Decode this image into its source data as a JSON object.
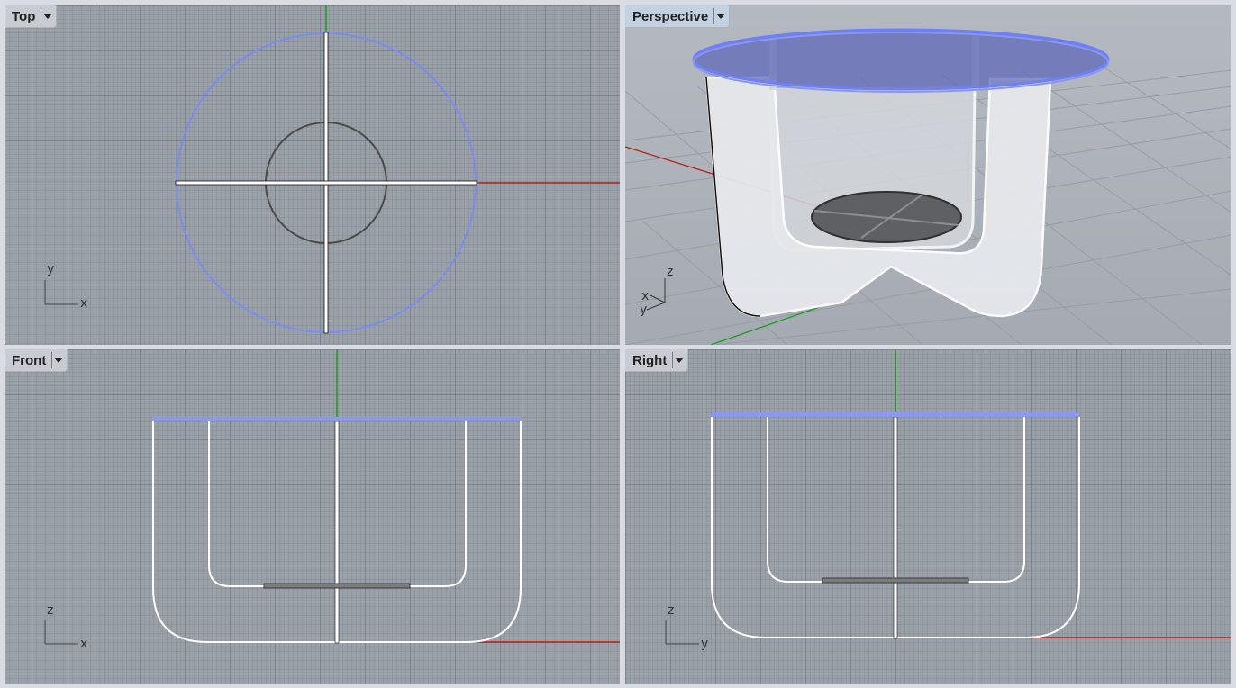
{
  "viewports": {
    "top": {
      "title": "Top",
      "axis_x": "x",
      "axis_y": "y"
    },
    "perspective": {
      "title": "Perspective",
      "axis_x": "x",
      "axis_y": "y",
      "axis_z": "z"
    },
    "front": {
      "title": "Front",
      "axis_x": "x",
      "axis_y": "z"
    },
    "right": {
      "title": "Right",
      "axis_x": "y",
      "axis_y": "z"
    }
  },
  "icons": {
    "viewport_menu": "chevron-down-icon"
  },
  "colors": {
    "selection": "#7b8cf0",
    "x_axis": "#b02020",
    "y_axis": "#1f9a1f",
    "grid_bg": "#9aa0a8",
    "active_tab": "#c3d2e3"
  }
}
